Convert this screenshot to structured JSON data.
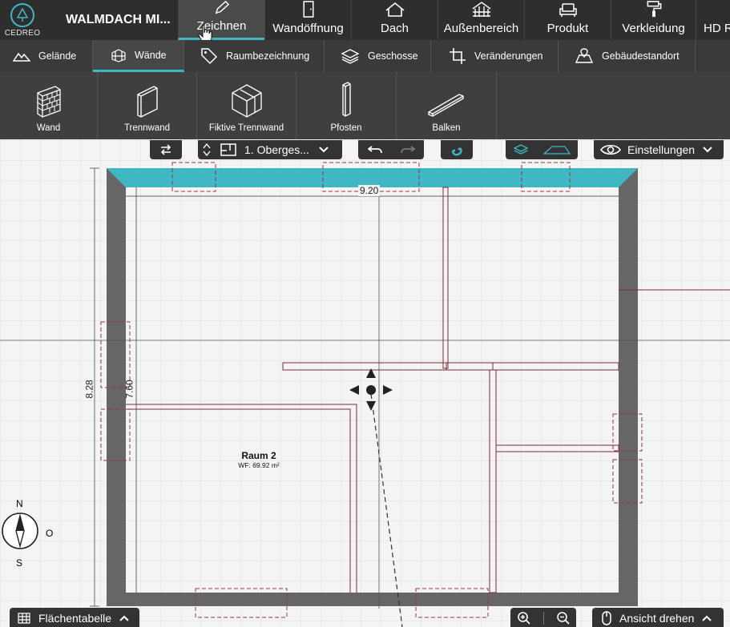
{
  "app": {
    "brand": "CEDREO",
    "project_title": "WALMDACH MI..."
  },
  "main_tabs": [
    {
      "label": "Zeichnen",
      "icon": "pencil-icon",
      "active": true
    },
    {
      "label": "Wandöffnung",
      "icon": "door-icon"
    },
    {
      "label": "Dach",
      "icon": "roof-icon"
    },
    {
      "label": "Außenbereich",
      "icon": "fence-icon"
    },
    {
      "label": "Produkt",
      "icon": "armchair-icon"
    },
    {
      "label": "Verkleidung",
      "icon": "paint-roller-icon"
    },
    {
      "label": "HD R",
      "icon": "render-icon"
    }
  ],
  "sub_tabs": [
    {
      "label": "Gelände",
      "icon": "terrain-icon"
    },
    {
      "label": "Wände",
      "icon": "brick-wall-icon",
      "active": true
    },
    {
      "label": "Raumbezeichnung",
      "icon": "tag-icon"
    },
    {
      "label": "Geschosse",
      "icon": "layers-icon"
    },
    {
      "label": "Veränderungen",
      "icon": "crop-icon"
    },
    {
      "label": "Gebäudestandort",
      "icon": "location-icon"
    }
  ],
  "tools": [
    {
      "label": "Wand",
      "icon": "wall-icon"
    },
    {
      "label": "Trennwand",
      "icon": "partition-wall-icon"
    },
    {
      "label": "Fiktive Trennwand",
      "icon": "virtual-wall-icon"
    },
    {
      "label": "Pfosten",
      "icon": "post-icon"
    },
    {
      "label": "Balken",
      "icon": "beam-icon"
    }
  ],
  "floor_selector": {
    "value": "1. Oberges..."
  },
  "settings_label": "Einstellungen",
  "plan": {
    "dimension_top": "9.20",
    "dimension_left_outer": "8.28",
    "dimension_left_inner": "7.60",
    "room_name": "Raum 2",
    "room_area": "WF: 69.92 m²"
  },
  "compass": {
    "north": "N",
    "east": "O",
    "south": "S"
  },
  "bottom": {
    "area_table": "Flächentabelle",
    "rotate_view": "Ansicht drehen"
  },
  "colors": {
    "accent": "#3fb8c4",
    "wall": "#666666",
    "topbar": "#2e2e2e",
    "partition": "#7a2a3a"
  }
}
